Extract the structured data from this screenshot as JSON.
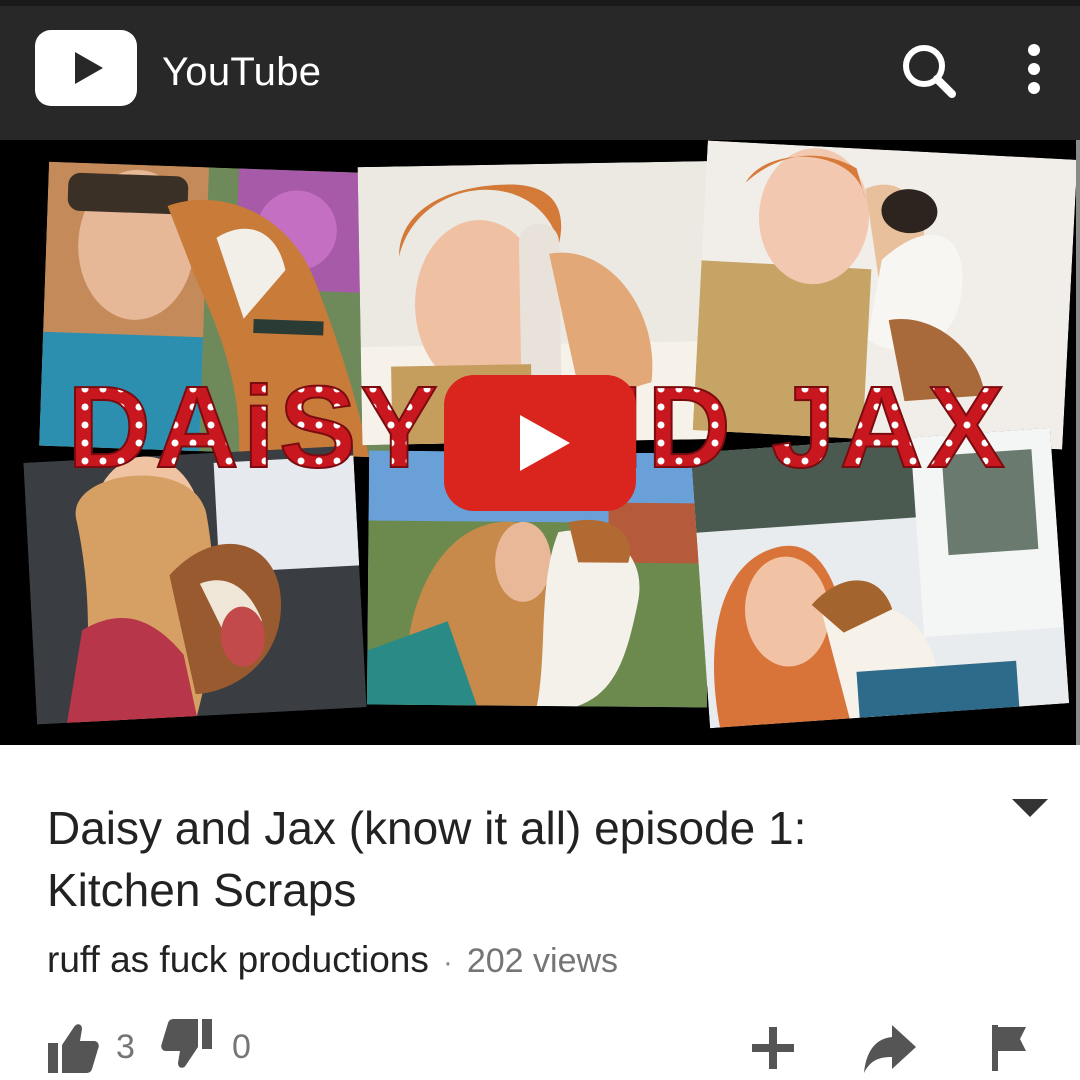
{
  "app": {
    "title": "YouTube",
    "logo_icon": "youtube-logo-icon",
    "brand_color": "#FF0000",
    "bar_color": "#282828"
  },
  "header": {
    "search_icon": "search-icon",
    "more_icon": "more-vert-icon"
  },
  "thumbnail": {
    "overlay_text": "DAiSY AND JAX",
    "overlay_color": "#C8171E",
    "play_icon": "play-icon"
  },
  "video": {
    "title": "Daisy and Jax (know it all) episode 1: Kitchen Scraps",
    "channel": "ruff as fuck productions",
    "separator": "·",
    "views": "202 views"
  },
  "actions": {
    "likes": "3",
    "dislikes": "0",
    "like_icon": "thumbs-up-icon",
    "dislike_icon": "thumbs-down-icon",
    "add_icon": "plus-icon",
    "share_icon": "share-icon",
    "flag_icon": "flag-icon",
    "collapse_icon": "chevron-down-icon"
  }
}
